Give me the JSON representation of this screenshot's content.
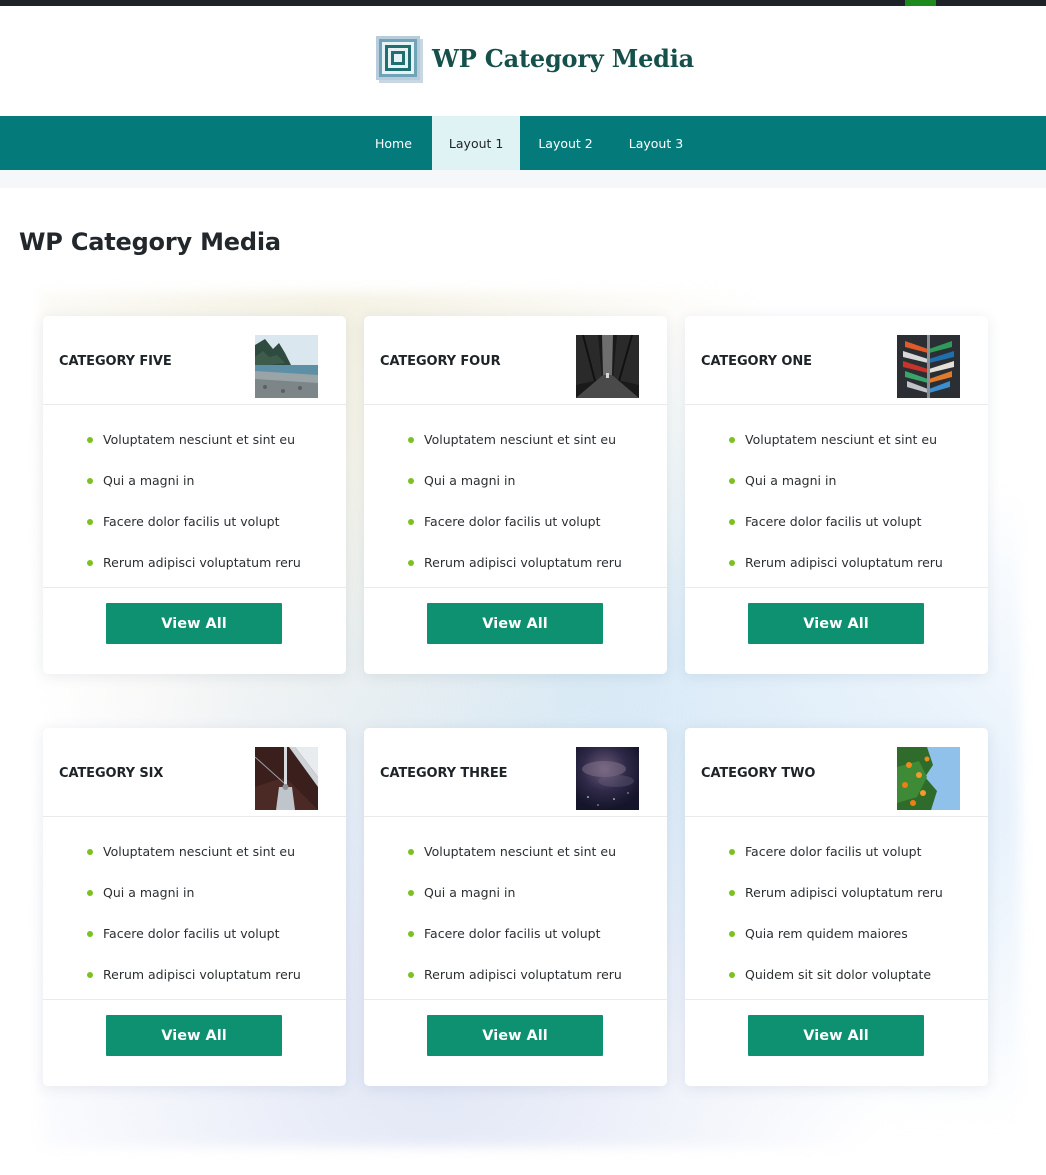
{
  "site": {
    "title": "WP Category Media"
  },
  "nav": {
    "items": [
      {
        "label": "Home",
        "active": false
      },
      {
        "label": "Layout 1",
        "active": true
      },
      {
        "label": "Layout 2",
        "active": false
      },
      {
        "label": "Layout 3",
        "active": false
      }
    ]
  },
  "page": {
    "title": "WP Category Media"
  },
  "theme": {
    "nav_bg": "#047b7a",
    "nav_active_bg": "#dff3f5",
    "button_bg": "#0d9170",
    "bullet": "#7bc11f",
    "logo_text": "#15504a"
  },
  "cards": [
    {
      "title": "CATEGORY FIVE",
      "thumb": "beach-coast-image",
      "items": [
        "Voluptatem nesciunt et sint eu",
        "Qui a magni in",
        "Facere dolor facilis ut volupt",
        "Rerum adipisci voluptatum reru"
      ],
      "button": "View All"
    },
    {
      "title": "CATEGORY FOUR",
      "thumb": "dark-forest-path-image",
      "items": [
        "Voluptatem nesciunt et sint eu",
        "Qui a magni in",
        "Facere dolor facilis ut volupt",
        "Rerum adipisci voluptatum reru"
      ],
      "button": "View All"
    },
    {
      "title": "CATEGORY ONE",
      "thumb": "stacked-kayaks-image",
      "items": [
        "Voluptatem nesciunt et sint eu",
        "Qui a magni in",
        "Facere dolor facilis ut volupt",
        "Rerum adipisci voluptatum reru"
      ],
      "button": "View All"
    },
    {
      "title": "CATEGORY SIX",
      "thumb": "sailboat-mast-image",
      "items": [
        "Voluptatem nesciunt et sint eu",
        "Qui a magni in",
        "Facere dolor facilis ut volupt",
        "Rerum adipisci voluptatum reru"
      ],
      "button": "View All"
    },
    {
      "title": "CATEGORY THREE",
      "thumb": "night-sky-image",
      "items": [
        "Voluptatem nesciunt et sint eu",
        "Qui a magni in",
        "Facere dolor facilis ut volupt",
        "Rerum adipisci voluptatum reru"
      ],
      "button": "View All"
    },
    {
      "title": "CATEGORY TWO",
      "thumb": "orange-tree-image",
      "items": [
        "Facere dolor facilis ut volupt",
        "Rerum adipisci voluptatum reru",
        "Quia rem quidem maiores",
        "Quidem sit sit dolor voluptate"
      ],
      "button": "View All"
    }
  ]
}
